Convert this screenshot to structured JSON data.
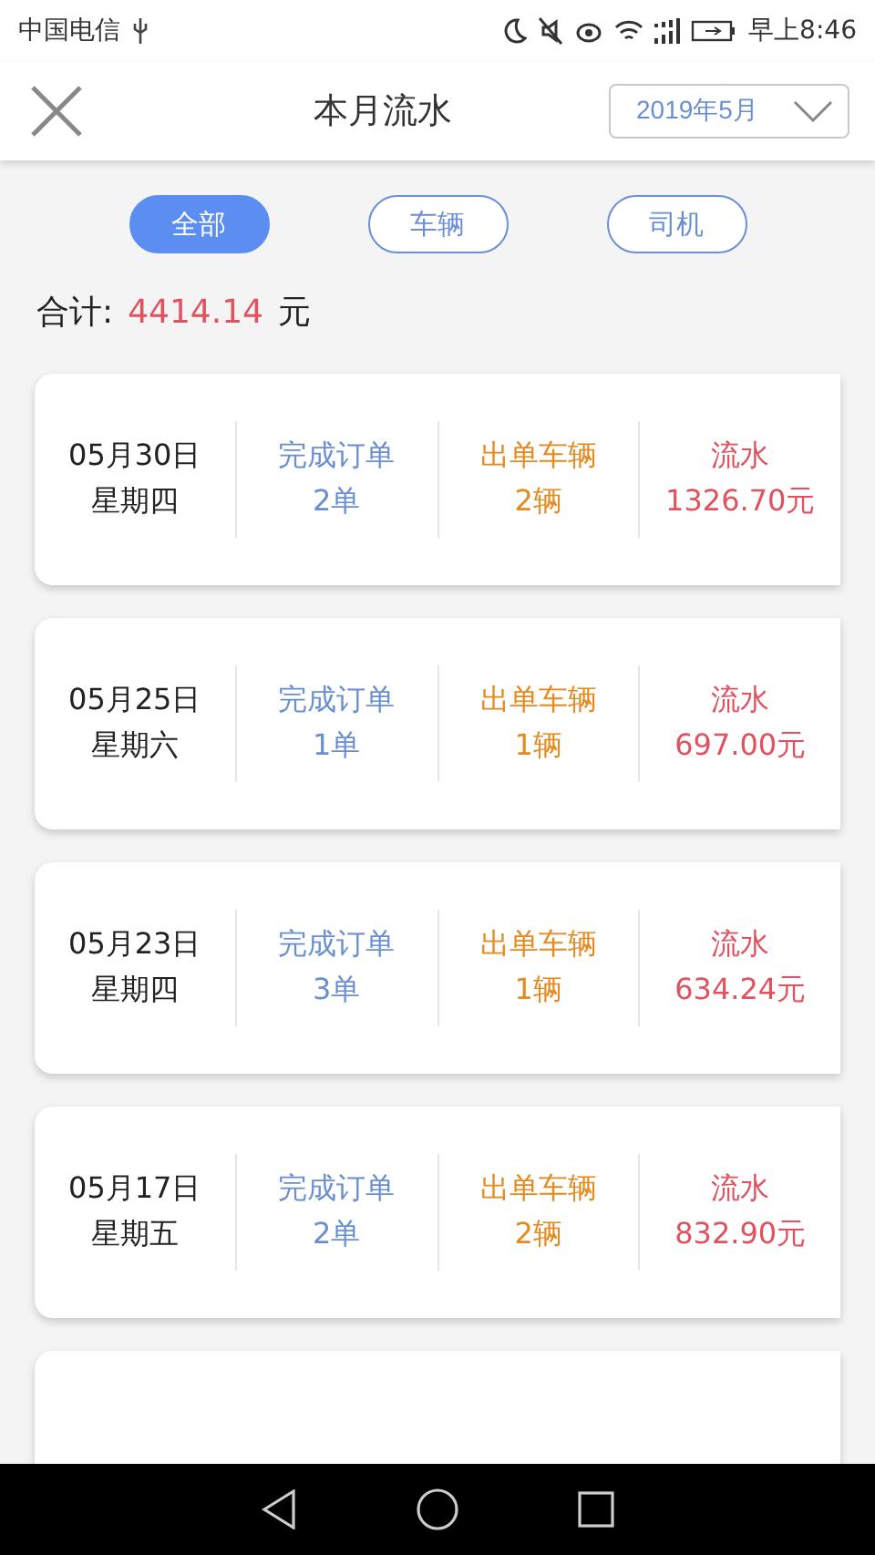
{
  "status_bar": {
    "carrier": "中国电信",
    "time": "早上8:46"
  },
  "header": {
    "title": "本月流水",
    "month_picker": "2019年5月"
  },
  "filters": [
    {
      "label": "全部",
      "selected": true
    },
    {
      "label": "车辆",
      "selected": false
    },
    {
      "label": "司机",
      "selected": false
    }
  ],
  "total": {
    "label": "合计:",
    "amount": "4414.14",
    "unit": "元"
  },
  "records": [
    {
      "kind": "full",
      "date": "05月30日",
      "weekday": "星期四",
      "orders_label": "完成订单",
      "orders": "2单",
      "vehicles_label": "出单车辆",
      "vehicles": "2辆",
      "revenue_label": "流水",
      "revenue": "1326.70元"
    },
    {
      "kind": "full",
      "date": "05月25日",
      "weekday": "星期六",
      "orders_label": "完成订单",
      "orders": "1单",
      "vehicles_label": "出单车辆",
      "vehicles": "1辆",
      "revenue_label": "流水",
      "revenue": "697.00元"
    },
    {
      "kind": "full",
      "date": "05月23日",
      "weekday": "星期四",
      "orders_label": "完成订单",
      "orders": "3单",
      "vehicles_label": "出单车辆",
      "vehicles": "1辆",
      "revenue_label": "流水",
      "revenue": "634.24元"
    },
    {
      "kind": "full",
      "date": "05月17日",
      "weekday": "星期五",
      "orders_label": "完成订单",
      "orders": "2单",
      "vehicles_label": "出单车辆",
      "vehicles": "2辆",
      "revenue_label": "流水",
      "revenue": "832.90元"
    },
    {
      "kind": "cut"
    }
  ]
}
